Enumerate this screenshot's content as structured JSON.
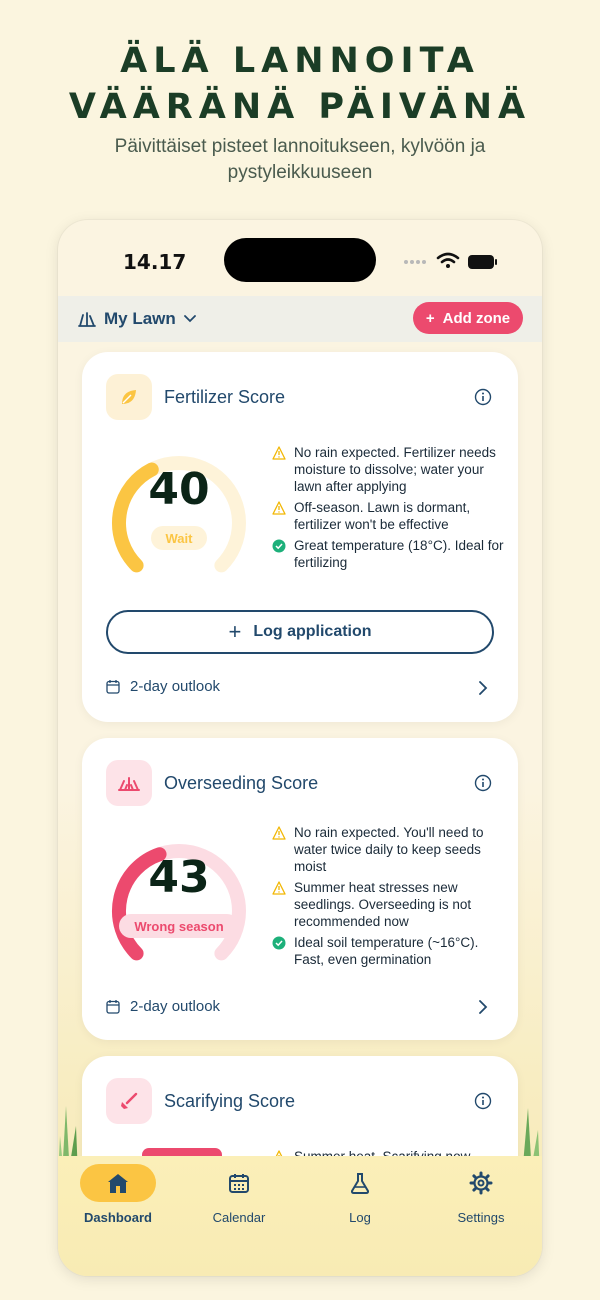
{
  "promo": {
    "headline": "ÄLÄ LANNOITA VÄÄRÄNÄ PÄIVÄNÄ",
    "subheadline": "Päivittäiset pisteet lannoitukseen, kylvöön ja pystyleikkuuseen"
  },
  "status_bar": {
    "time": "14.17"
  },
  "app_bar": {
    "lawn_name": "My Lawn",
    "add_zone_label": "Add zone"
  },
  "cards": [
    {
      "title": "Fertilizer Score",
      "icon": "leaf-icon",
      "score": "40",
      "score_fraction": 0.4,
      "status": "Wait",
      "notes": [
        {
          "type": "warning",
          "text": "No rain expected. Fertilizer needs moisture to dissolve; water your lawn after applying"
        },
        {
          "type": "warning",
          "text": "Off-season. Lawn is dormant, fertilizer won't be effective"
        },
        {
          "type": "ok",
          "text": "Great temperature (18°C). Ideal for fertilizing"
        }
      ],
      "action_label": "Log application",
      "outlook_label": "2-day outlook"
    },
    {
      "title": "Overseeding Score",
      "icon": "grass-sprout-icon",
      "score": "43",
      "score_fraction": 0.43,
      "status": "Wrong season",
      "notes": [
        {
          "type": "warning",
          "text": "No rain expected. You'll need to water twice daily to keep seeds moist"
        },
        {
          "type": "warning",
          "text": "Summer heat stresses new seedlings. Overseeding is not recommended now"
        },
        {
          "type": "ok",
          "text": "Ideal soil temperature (~16°C). Fast, even germination"
        }
      ],
      "outlook_label": "2-day outlook"
    },
    {
      "title": "Scarifying Score",
      "icon": "rake-icon",
      "notes": [
        {
          "type": "warning",
          "text": "Summer heat. Scarifying now"
        }
      ]
    }
  ],
  "tabs": [
    {
      "label": "Dashboard",
      "icon": "home-icon",
      "active": true
    },
    {
      "label": "Calendar",
      "icon": "calendar-icon",
      "active": false
    },
    {
      "label": "Log",
      "icon": "flask-icon",
      "active": false
    },
    {
      "label": "Settings",
      "icon": "gear-icon",
      "active": false
    }
  ],
  "colors": {
    "background": "#fbf5df",
    "headline": "#1b3d26",
    "navy": "#22496c",
    "accent_pink": "#ec4a6e",
    "fertilizer_yellow": "#fbc543",
    "overseeding_red": "#ec4a6e",
    "warning_yellow": "#f2b705",
    "ok_green": "#1db07a"
  }
}
